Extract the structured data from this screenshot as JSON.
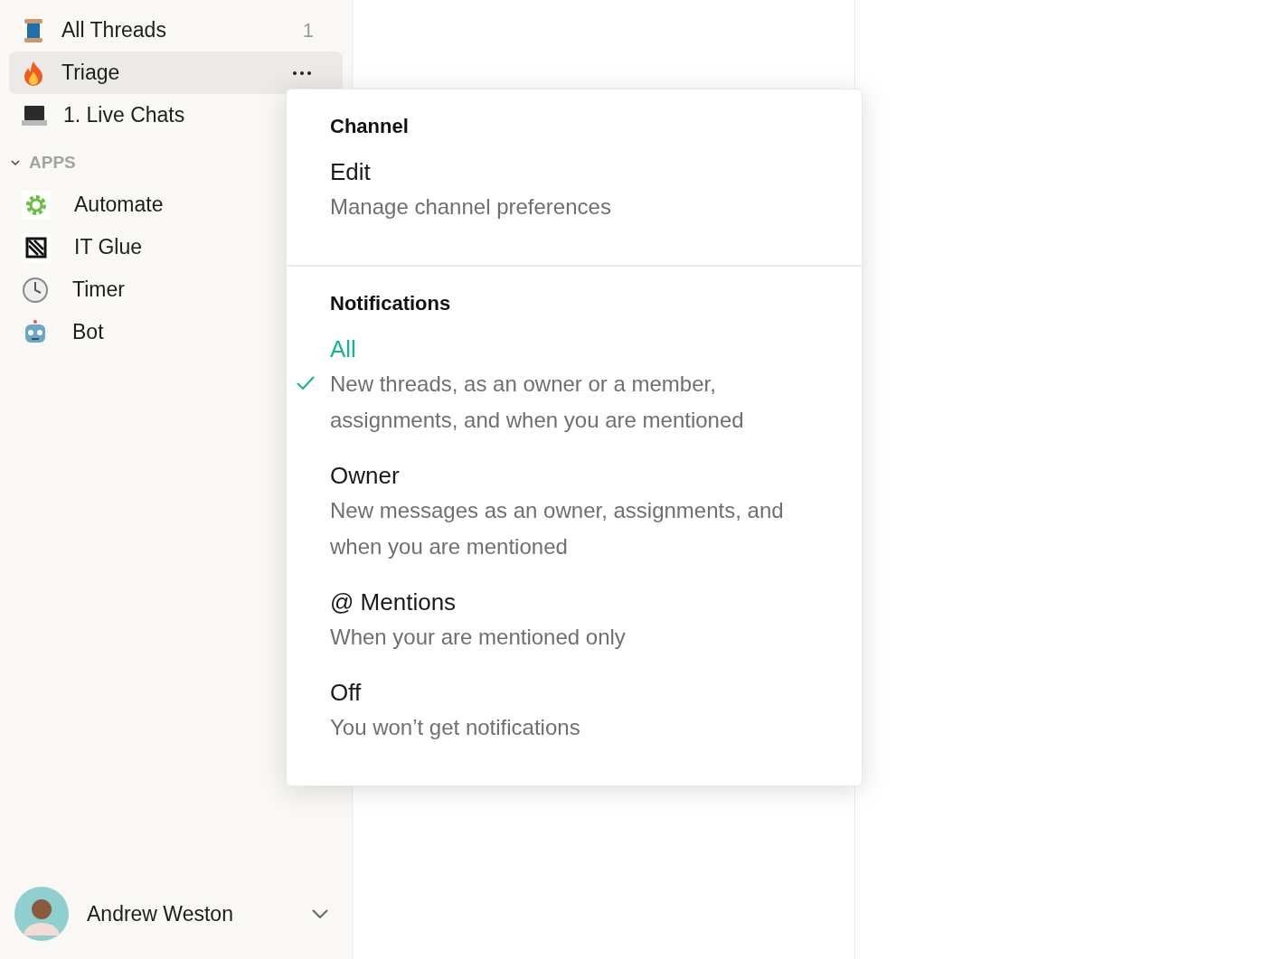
{
  "sidebar": {
    "threads": [
      {
        "label": "All Threads",
        "count": "1",
        "selected": false
      },
      {
        "label": "Triage",
        "selected": true
      },
      {
        "label": "1. Live Chats",
        "selected": false
      }
    ],
    "apps_section": {
      "title": "APPS",
      "expanded": true,
      "items": [
        {
          "label": "Automate"
        },
        {
          "label": "IT Glue"
        },
        {
          "label": "Timer"
        },
        {
          "label": "Bot"
        }
      ]
    },
    "user": {
      "name": "Andrew Weston"
    }
  },
  "menu": {
    "channel": {
      "heading": "Channel",
      "items": [
        {
          "title": "Edit",
          "description": "Manage channel preferences"
        }
      ]
    },
    "notifications": {
      "heading": "Notifications",
      "options": [
        {
          "title": "All",
          "description": "New threads, as an owner or a member, assignments, and when you are mentioned",
          "selected": true
        },
        {
          "title": "Owner",
          "description": "New messages as an owner, assignments, and when you are mentioned",
          "selected": false
        },
        {
          "title": "@ Mentions",
          "description": "When your are mentioned only",
          "selected": false
        },
        {
          "title": "Off",
          "description": "You won’t get notifications",
          "selected": false
        }
      ]
    }
  }
}
